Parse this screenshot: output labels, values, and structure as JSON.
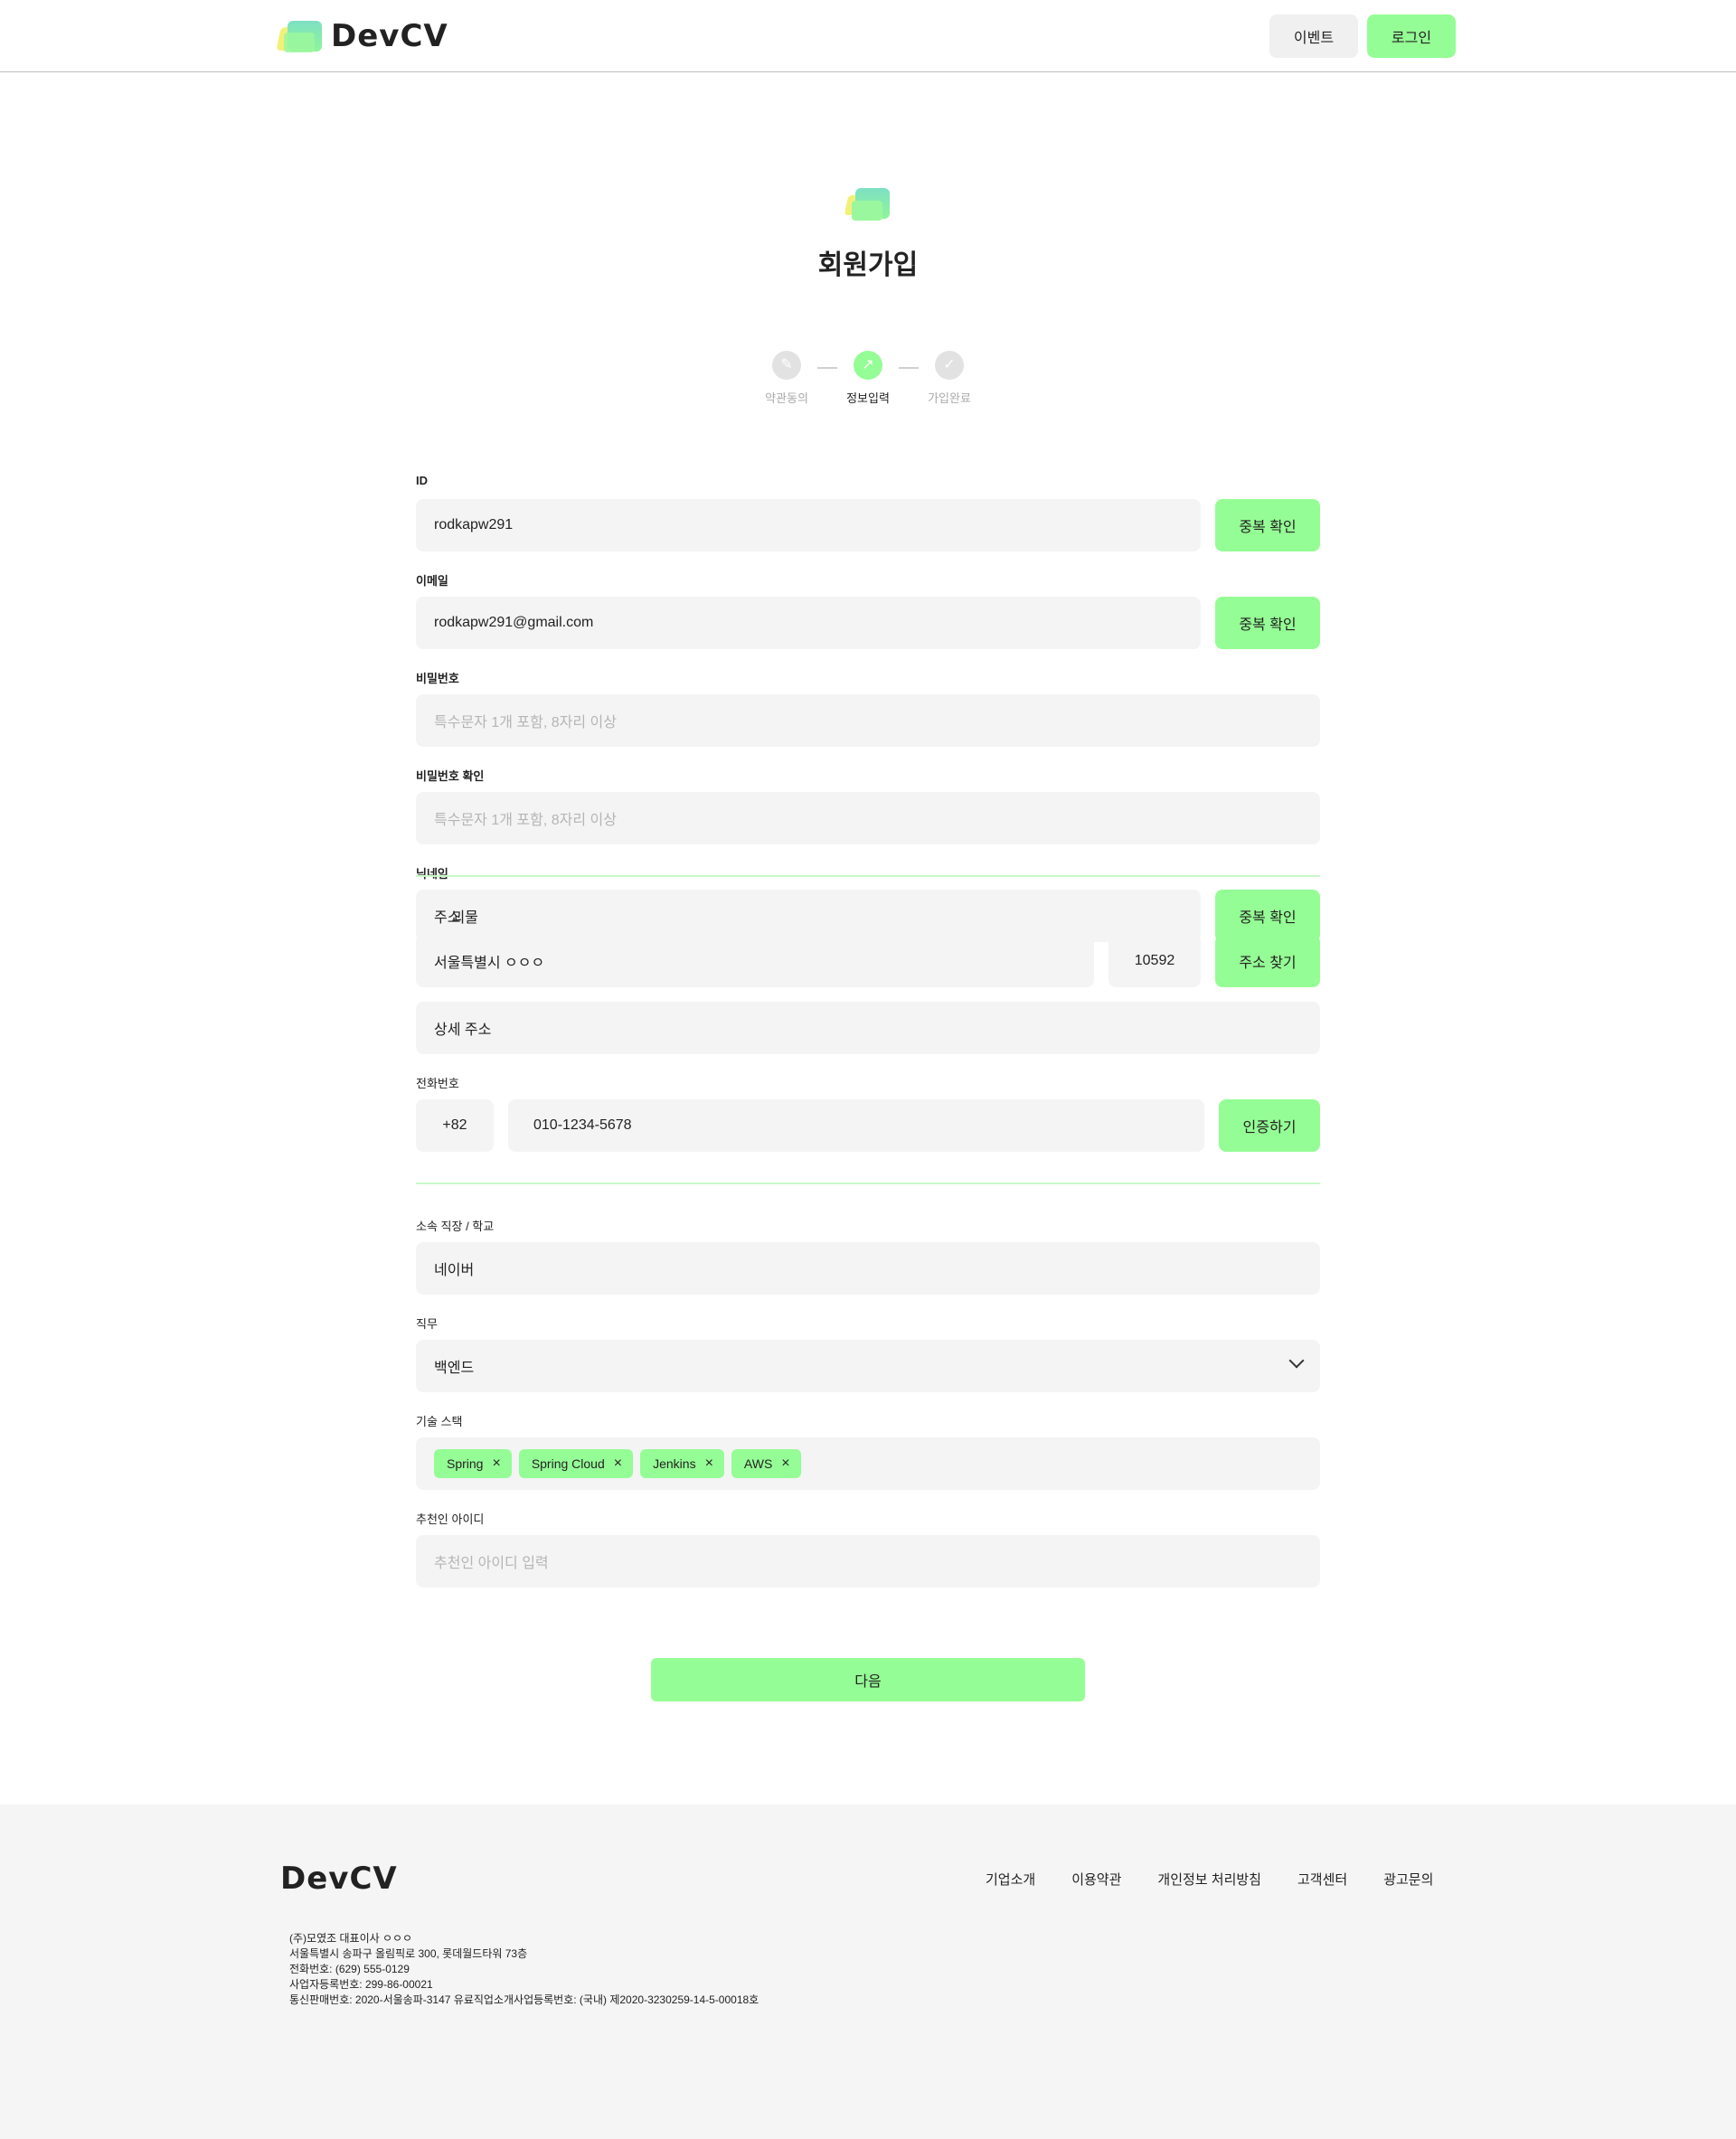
{
  "header": {
    "logo_text": "DevCV",
    "event_label": "이벤트",
    "login_label": "로그인"
  },
  "title": "회원가입",
  "steps": [
    {
      "label": "약관동의",
      "icon": "pencil-icon",
      "state": "done"
    },
    {
      "label": "정보입력",
      "icon": "arrow-icon",
      "state": "active"
    },
    {
      "label": "가입완료",
      "icon": "check-icon",
      "state": "pending"
    }
  ],
  "form": {
    "id": {
      "label": "ID",
      "value": "rodkapw291",
      "button": "중복 확인"
    },
    "email": {
      "label": "이메일",
      "value": "rodkapw291@gmail.com",
      "button": "중복 확인"
    },
    "password": {
      "label": "비밀번호",
      "placeholder": "특수문자 1개 포함, 8자리 이상"
    },
    "password_confirm": {
      "label": "비밀번호 확인",
      "placeholder": "특수문자 1개 포함, 8자리 이상"
    },
    "nickname": {
      "label": "닉네임",
      "value": "괴물",
      "button": "중복 확인"
    },
    "address": {
      "label": "주소",
      "value": "서울특별시 ㅇㅇㅇ",
      "zip": "10592",
      "button": "주소 찾기",
      "detail_value": "상세 주소"
    },
    "phone": {
      "label": "전화번호",
      "country": "+82",
      "value": "010-1234-5678",
      "button": "인증하기"
    },
    "company": {
      "label": "소속 직장 /  학교",
      "value": "네이버"
    },
    "job": {
      "label": "직무",
      "value": "백엔드"
    },
    "stack": {
      "label": "기술 스택",
      "tags": [
        "Spring",
        "Spring Cloud",
        "Jenkins",
        "AWS"
      ]
    },
    "referrer": {
      "label": "추천인 아이디",
      "placeholder": "추천인 아이디 입력"
    }
  },
  "next_label": "다음",
  "footer": {
    "logo_text": "DevCV",
    "links": [
      "기업소개",
      "이용약관",
      "개인정보 처리방침",
      "고객센터",
      "광고문의"
    ],
    "info": [
      "(주)모였조   대표이사 ㅇㅇㅇ",
      "서울특별시 송파구 올림픽로 300, 롯데월드타워 73층",
      "전화번호: (629) 555-0129",
      "사업자등록번호: 299-86-00021",
      "통신판매번호: 2020-서울송파-3147  유료직업소개사업등록번호: (국내) 제2020-3230259-14-5-00018호"
    ]
  },
  "colors": {
    "accent": "#95fd95",
    "field_bg": "#f4f4f4",
    "footer_bg": "#f5f5f5"
  }
}
